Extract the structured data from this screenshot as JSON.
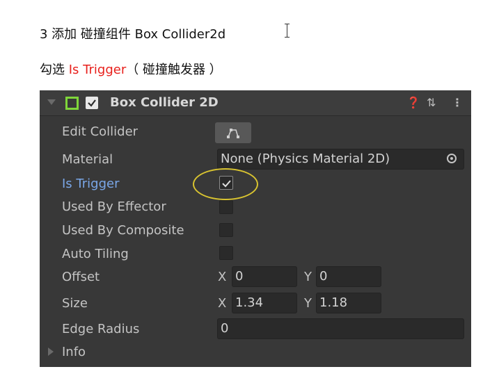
{
  "doc": {
    "line1": "3 添加 碰撞组件 Box Collider2d",
    "line2_prefix": "勾选 ",
    "line2_highlight": "Is Trigger",
    "line2_suffix": "（ 碰撞触发器 ）"
  },
  "component": {
    "title": "Box Collider 2D",
    "enabled": true,
    "header_icons": [
      "help-icon",
      "preset-icon",
      "more-icon"
    ]
  },
  "fields": {
    "edit_collider": "Edit Collider",
    "material_label": "Material",
    "material_value": "None (Physics Material 2D)",
    "is_trigger_label": "Is Trigger",
    "is_trigger": true,
    "used_by_effector_label": "Used By Effector",
    "used_by_effector": false,
    "used_by_composite_label": "Used By Composite",
    "used_by_composite": false,
    "auto_tiling_label": "Auto Tiling",
    "auto_tiling": false,
    "offset_label": "Offset",
    "offset_x_axis": "X",
    "offset_x": "0",
    "offset_y_axis": "Y",
    "offset_y": "0",
    "size_label": "Size",
    "size_x_axis": "X",
    "size_x": "1.34",
    "size_y_axis": "Y",
    "size_y": "1.18",
    "edge_radius_label": "Edge Radius",
    "edge_radius": "0",
    "info_label": "Info"
  },
  "colors": {
    "accent_red": "#e8201c",
    "active_label_blue": "#7aa7e8",
    "component_icon_green": "#7fd63a",
    "annotation_yellow": "#d9c430",
    "panel_bg": "#383838"
  }
}
